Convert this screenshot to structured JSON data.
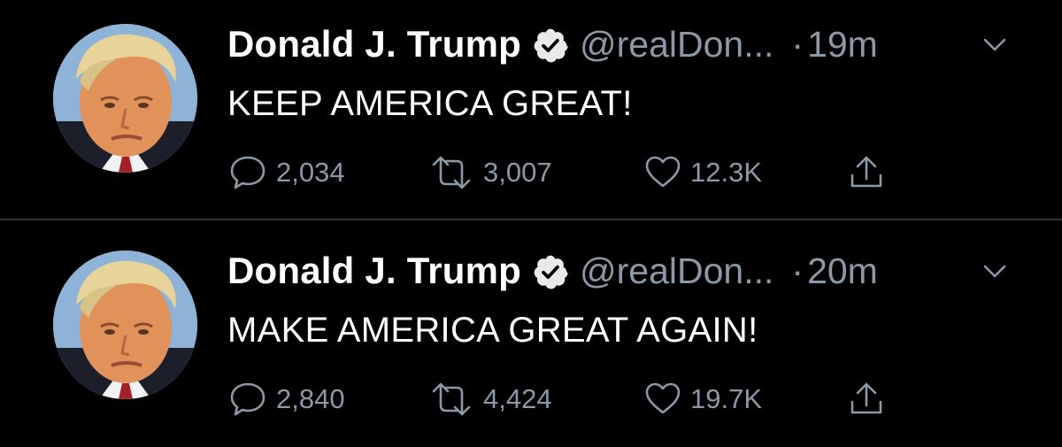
{
  "colors": {
    "background": "#000000",
    "divider": "#2f3336",
    "primary_text": "#ffffff",
    "secondary_text": "#8b98a5"
  },
  "tweets": [
    {
      "author_name": "Donald J. Trump",
      "handle": "@realDon...",
      "separator": "·",
      "time": "19m",
      "text": "KEEP AMERICA GREAT!",
      "reply_count": "2,034",
      "retweet_count": "3,007",
      "like_count": "12.3K",
      "icons": [
        "avatar",
        "verified-badge-icon",
        "chevron-down-icon",
        "reply-icon",
        "retweet-icon",
        "heart-icon",
        "share-icon"
      ]
    },
    {
      "author_name": "Donald J. Trump",
      "handle": "@realDon...",
      "separator": "·",
      "time": "20m",
      "text": "MAKE AMERICA GREAT AGAIN!",
      "reply_count": "2,840",
      "retweet_count": "4,424",
      "like_count": "19.7K",
      "icons": [
        "avatar",
        "verified-badge-icon",
        "chevron-down-icon",
        "reply-icon",
        "retweet-icon",
        "heart-icon",
        "share-icon"
      ]
    }
  ]
}
